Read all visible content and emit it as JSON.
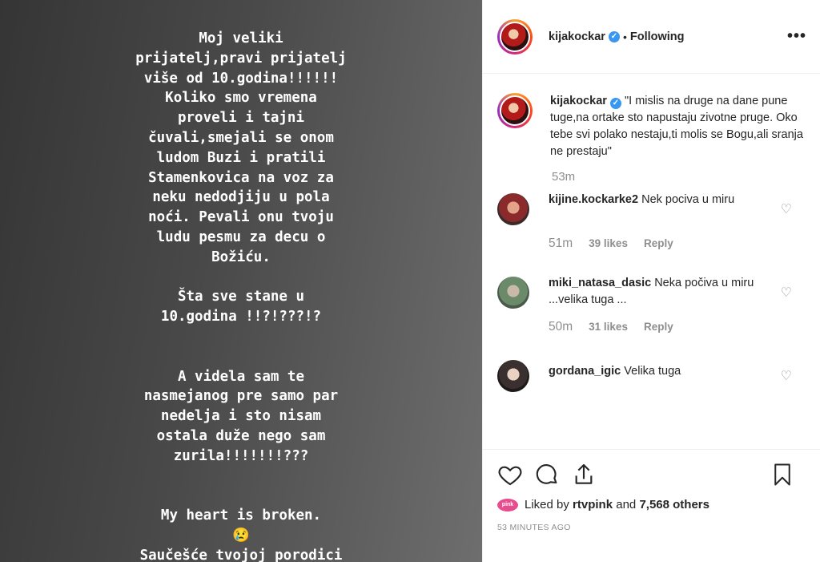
{
  "story": {
    "text": "Moj veliki\nprijatelj,pravi prijatelj\nviše od 10.godina!!!!!!\nKoliko smo vremena\nproveli i tajni\nčuvali,smejali se onom\nludom Buzi i pratili\nStamenkovica na voz za\nneku nedodjiju u pola\nnoći. Pevali onu tvoju\nludu pesmu za decu o\nBožiću.\n\nŠta sve stane u\n10.godina !!?!???!?\n\n\nA videla sam te\nnasmejanog pre samo par\nnedelja i sto nisam\nostala duže nego sam\nzurila!!!!!!!???\n\n\nMy heart is broken.\n😢\nSaučešće tvojoj porodici"
  },
  "header": {
    "username": "kijakockar",
    "separator": "•",
    "follow_status": "Following",
    "more_label": "•••"
  },
  "caption": {
    "username": "kijakockar",
    "text": "\"I mislis na druge na dane pune tuge,na ortake sto napustaju zivotne pruge. Oko tebe svi polako nestaju,ti molis se Bogu,ali sranja ne prestaju\"",
    "time": "53m"
  },
  "comments": [
    {
      "username": "kijine.kockarke2",
      "text": "Nek pociva u miru",
      "time": "51m",
      "likes": "39 likes",
      "reply": "Reply"
    },
    {
      "username": "miki_natasa_dasic",
      "text": "Neka počiva u miru ...velika tuga ...",
      "time": "50m",
      "likes": "31 likes",
      "reply": "Reply"
    },
    {
      "username": "gordana_igic",
      "text": "Velika tuga"
    }
  ],
  "likes": {
    "logo_text": "pink",
    "prefix": "Liked by",
    "user": "rtvpink",
    "middle": "and",
    "count_text": "7,568 others"
  },
  "timestamp": "53 MINUTES AGO",
  "colors": {
    "verified": "#3897f0",
    "muted": "#8e8e8e",
    "text": "#262626"
  },
  "icons": [
    "heart-icon",
    "comment-icon",
    "share-icon",
    "bookmark-icon",
    "verified-badge-icon"
  ]
}
